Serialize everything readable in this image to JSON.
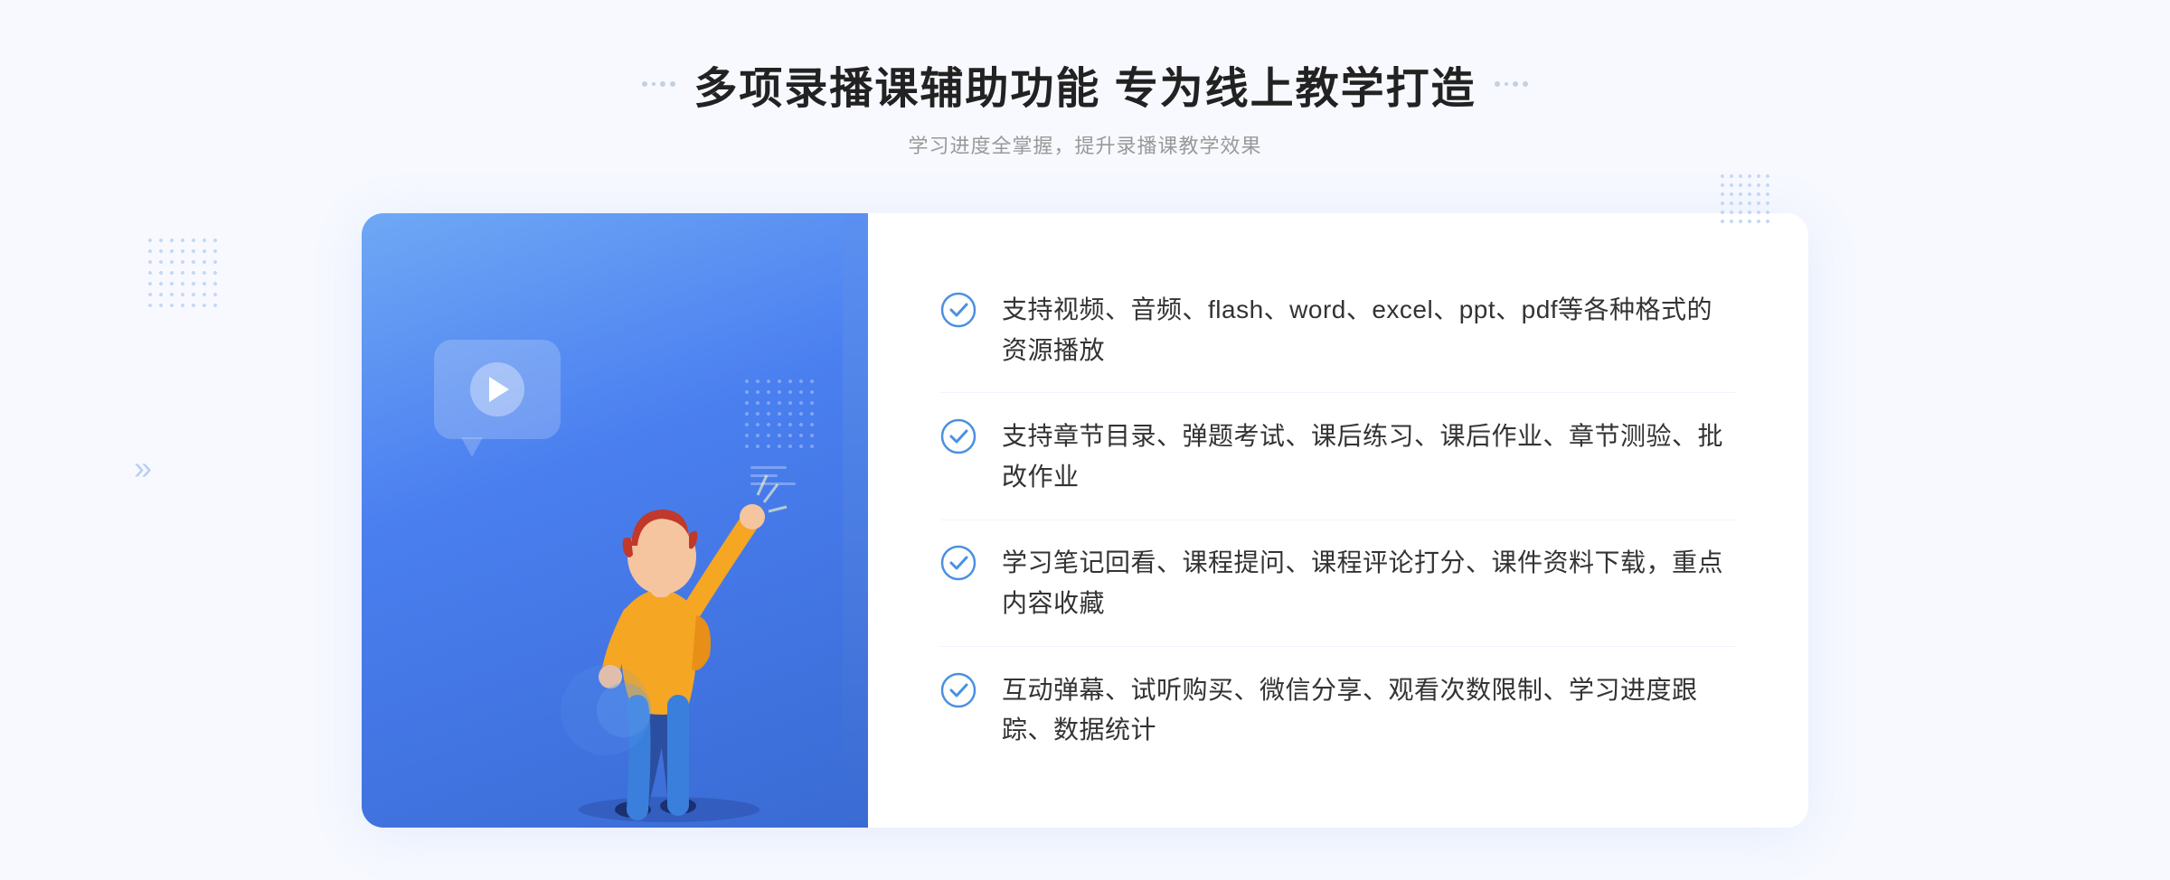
{
  "header": {
    "title": "多项录播课辅助功能 专为线上教学打造",
    "subtitle": "学习进度全掌握，提升录播课教学效果"
  },
  "features": [
    {
      "id": 1,
      "text": "支持视频、音频、flash、word、excel、ppt、pdf等各种格式的资源播放"
    },
    {
      "id": 2,
      "text": "支持章节目录、弹题考试、课后练习、课后作业、章节测验、批改作业"
    },
    {
      "id": 3,
      "text": "学习笔记回看、课程提问、课程评论打分、课件资料下载，重点内容收藏"
    },
    {
      "id": 4,
      "text": "互动弹幕、试听购买、微信分享、观看次数限制、学习进度跟踪、数据统计"
    }
  ],
  "decorations": {
    "chevron": "»",
    "play_button_label": "play"
  }
}
